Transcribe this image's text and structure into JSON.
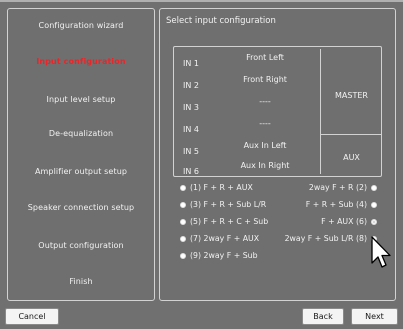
{
  "sidebar": {
    "items": [
      {
        "label": "Configuration wizard"
      },
      {
        "label": "Input configuration"
      },
      {
        "label": "Input level setup"
      },
      {
        "label": "De-equalization"
      },
      {
        "label": "Amplifier output setup"
      },
      {
        "label": "Speaker connection setup"
      },
      {
        "label": "Output configuration"
      },
      {
        "label": "Finish"
      }
    ],
    "active_index": 1
  },
  "main": {
    "title": "Select input configuration",
    "inputs": [
      {
        "in": "IN 1",
        "name": "Front Left"
      },
      {
        "in": "IN 2",
        "name": "Front Right"
      },
      {
        "in": "IN 3",
        "name": "----"
      },
      {
        "in": "IN 4",
        "name": "----"
      },
      {
        "in": "IN 5",
        "name": "Aux In Left"
      },
      {
        "in": "IN 6",
        "name": "Aux In Right"
      }
    ],
    "groups": {
      "master": "MASTER",
      "aux": "AUX"
    },
    "options": [
      {
        "label": "(1) F + R + AUX",
        "checked": false
      },
      {
        "label": "2way F + R (2)",
        "checked": false
      },
      {
        "label": "(3) F + R + Sub L/R",
        "checked": false
      },
      {
        "label": "F + R + Sub (4)",
        "checked": false
      },
      {
        "label": "(5) F + R + C + Sub",
        "checked": false
      },
      {
        "label": "F + AUX (6)",
        "checked": true
      },
      {
        "label": "(7) 2way F + AUX",
        "checked": false
      },
      {
        "label": "2way F + Sub L/R (8)",
        "checked": false
      },
      {
        "label": "(9) 2way F + Sub",
        "checked": false
      }
    ]
  },
  "footer": {
    "cancel_label": "Cancel",
    "back_label": "Back",
    "next_label": "Next"
  },
  "colors": {
    "background": "#707070",
    "active_item": "#e8262a",
    "border": "#d2d2d2"
  }
}
